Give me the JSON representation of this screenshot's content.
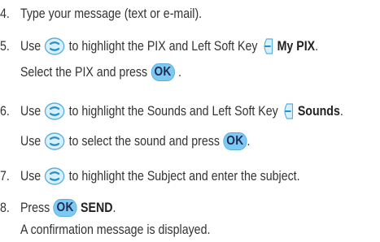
{
  "steps": [
    {
      "number": "4.",
      "text": "Type your message (text or e-mail)."
    },
    {
      "number": "5.",
      "use": "Use",
      "text_a": "to highlight the PIX and Left Soft Key",
      "softkey_label": "My PIX",
      "softkey_end": ".",
      "line2_a": "Select the PIX and press",
      "line2_ok": "OK",
      "line2_end": "."
    },
    {
      "number": "6.",
      "use": "Use",
      "text_a": "to highlight the Sounds and Left Soft Key",
      "softkey_label": "Sounds",
      "softkey_end": ".",
      "line2_use": "Use",
      "line2_a": "to select the sound and press",
      "line2_ok": "OK",
      "line2_end": "."
    },
    {
      "number": "7.",
      "use": "Use",
      "text_a": "to highlight the Subject and enter the subject."
    },
    {
      "number": "8.",
      "press": "Press",
      "ok": "OK",
      "send": "SEND",
      "send_end": ".",
      "line2": "A confirmation message is displayed."
    }
  ],
  "icons": {
    "nav_key": "navigation-key-icon",
    "left_soft_key": "left-soft-key-icon",
    "ok_key": "ok-key-icon"
  },
  "colors": {
    "ok_key_fill": "#7ec9f2",
    "ok_key_text": "#1d2d55",
    "nav_key_fill": "#d8f0fb",
    "nav_key_stroke": "#5aaede"
  }
}
